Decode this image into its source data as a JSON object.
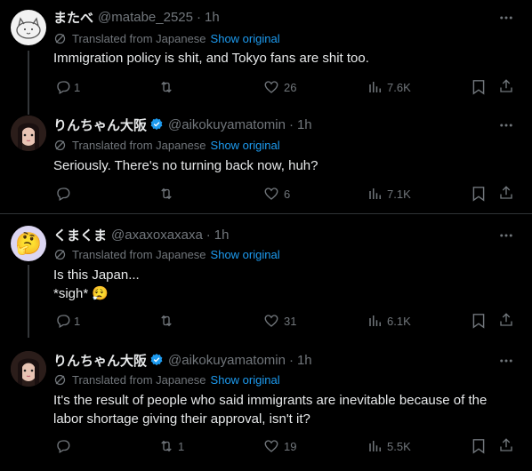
{
  "translated_label": "Translated from Japanese",
  "show_original_label": "Show original",
  "tweets": [
    {
      "name": "またべ",
      "handle": "@matabe_2525",
      "time": "1h",
      "text": "Immigration policy is shit, and Tokyo fans are shit too.",
      "replies": "1",
      "retweets": "",
      "likes": "26",
      "views": "7.6K"
    },
    {
      "name": "りんちゃん大阪",
      "handle": "@aikokuyamatomin",
      "time": "1h",
      "verified": true,
      "text": "Seriously. There's no turning back now, huh?",
      "replies": "",
      "retweets": "",
      "likes": "6",
      "views": "7.1K"
    },
    {
      "name": "くまくま",
      "handle": "@axaxoxaxaxa",
      "time": "1h",
      "text_line1": "Is this Japan...",
      "text_line2": "*sigh*",
      "emoji": "😮‍💨",
      "avatar_emoji": "🤔",
      "replies": "1",
      "retweets": "",
      "likes": "31",
      "views": "6.1K"
    },
    {
      "name": "りんちゃん大阪",
      "handle": "@aikokuyamatomin",
      "time": "1h",
      "verified": true,
      "text_line1": "It's the result of people who said immigrants are inevitable because of the",
      "text_line2": "labor shortage giving their approval, isn't it?",
      "replies": "",
      "retweets": "1",
      "likes": "19",
      "views": "5.5K"
    }
  ],
  "colors": {
    "background": "#000000",
    "text": "#e7e9ea",
    "muted": "#71767b",
    "link": "#1d9bf0",
    "divider": "#2f3336"
  }
}
